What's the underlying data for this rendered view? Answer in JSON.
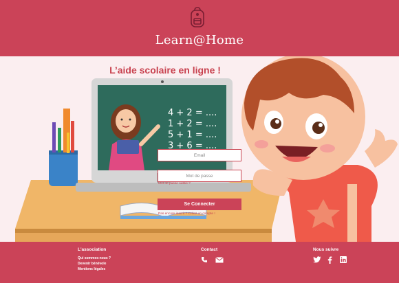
{
  "header": {
    "brand": "Learn@Home",
    "logo_icon": "backpack-icon"
  },
  "hero": {
    "title": "L’aide scolaire en ligne !",
    "chalkboard_lines": [
      "4 + 2 = ....",
      "1 + 2 = ....",
      "5 + 1 = ....",
      "3 + 6 = ...."
    ],
    "illustration": "teacher-and-child-illustration"
  },
  "login": {
    "email_placeholder": "Email",
    "password_placeholder": "Mot de passe",
    "forgot_label": "Mot de passe oublié ?",
    "submit_label": "Se Connecter",
    "signup_label": "Pas encore inscrit ? Créez un compte !"
  },
  "footer": {
    "association": {
      "title": "L'association",
      "links": [
        "Qui sommes-nous ?",
        "Devenir bénévole",
        "Mentions légales"
      ]
    },
    "contact": {
      "title": "Contact",
      "icons": [
        "phone-icon",
        "mail-icon"
      ]
    },
    "social": {
      "title": "Nous suivre",
      "icons": [
        "twitter-icon",
        "facebook-icon",
        "linkedin-icon"
      ]
    }
  },
  "colors": {
    "brand": "#cb4358",
    "background": "#fbeef0",
    "accent_text": "#c8424f"
  }
}
